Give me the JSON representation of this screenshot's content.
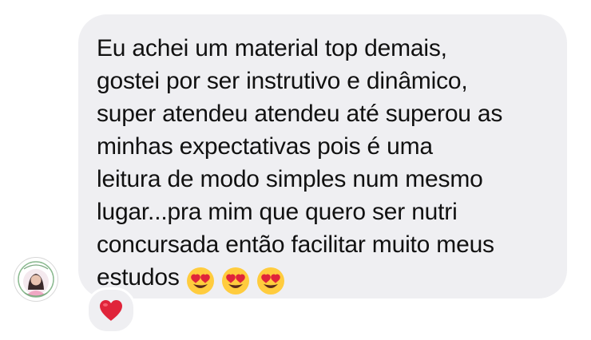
{
  "message": {
    "text": "Eu achei um material top demais,\ngostei por ser instrutivo e dinâmico,\nsuper atendeu atendeu até superou as\nminhas expectativas pois é uma\nleitura de modo simples num mesmo\nlugar...pra mim que quero ser nutri\nconcursada então facilitar muito meus\nestudos",
    "emojis": [
      "heart-eyes-emoji",
      "heart-eyes-emoji",
      "heart-eyes-emoji"
    ]
  },
  "reaction": {
    "icon": "red-heart-icon"
  },
  "avatar": {
    "icon": "profile-avatar"
  },
  "colors": {
    "bubble": "#efeff2",
    "text": "#111111",
    "heart": "#e0243a",
    "emoji_face": "#ffcc3e"
  }
}
